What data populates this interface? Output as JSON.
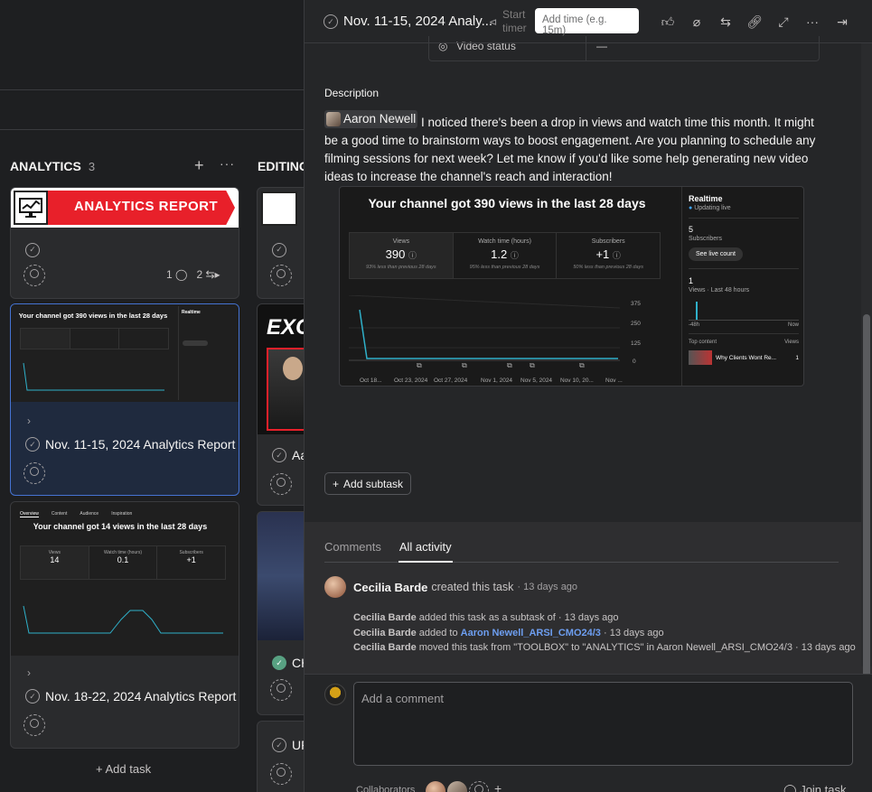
{
  "board": {
    "columns": [
      {
        "title": "ANALYTICS",
        "count": "3",
        "cards": [
          {
            "banner_text": "ANALYTICS REPORT",
            "comments": "1",
            "subtasks": "2"
          },
          {
            "title": "Nov. 11-15, 2024 Analytics Report",
            "preview_title": "Your channel got 390 views in the last 28 days"
          },
          {
            "title": "Nov. 18-22, 2024 Analytics Report",
            "preview_title": "Your channel got 14 views in the last 28 days",
            "preview_tabs": [
              "Overview",
              "Content",
              "Audience",
              "Inspiration"
            ],
            "preview_stats": [
              {
                "label": "Views",
                "value": "14"
              },
              {
                "label": "Watch time (hours)",
                "value": "0.1"
              },
              {
                "label": "Subscribers",
                "value": "+1"
              }
            ]
          }
        ],
        "add_task": "Add task"
      },
      {
        "title": "EDITING",
        "cards": [
          {
            "title": "Aa"
          },
          {
            "title": "CH"
          },
          {
            "title": "UP"
          }
        ]
      }
    ]
  },
  "panel": {
    "title": "Nov. 11-15, 2024 Analy...",
    "start_timer": "Start timer",
    "add_time_placeholder": "Add time (e.g. 15m)",
    "video_status_label": "Video status",
    "video_status_value": "—",
    "description_label": "Description",
    "mention_name": "Aaron Newell",
    "description_text": " I noticed there's been a drop in views and watch time this month. It might be a good time to brainstorm ways to boost engagement. Are you planning to schedule any filming sessions for next week? Let me know if you'd like some help generating new video ideas to increase the channel's reach and interaction!",
    "embed": {
      "title": "Your channel got 390 views in the last 28 days",
      "stats": [
        {
          "label": "Views",
          "value": "390",
          "sub": "93% less than previous 28 days"
        },
        {
          "label": "Watch time (hours)",
          "value": "1.2",
          "sub": "95% less than previous 28 days"
        },
        {
          "label": "Subscribers",
          "value": "+1",
          "sub": "50% less than previous 28 days"
        }
      ],
      "y_ticks": [
        "375",
        "250",
        "125",
        "0"
      ],
      "x_ticks": [
        "Oct 18...",
        "Oct 23, 2024",
        "Oct 27, 2024",
        "Nov 1, 2024",
        "Nov 5, 2024",
        "Nov 10, 20...",
        "Nov ..."
      ],
      "realtime_title": "Realtime",
      "realtime_status": "Updating live",
      "subs_value": "5",
      "subs_label": "Subscribers",
      "live_count_btn": "See live count",
      "views_value": "1",
      "views_label": "Views · Last 48 hours",
      "rt_x_start": "-48h",
      "rt_x_end": "Now",
      "top_content_label": "Top content",
      "top_content_views_label": "Views",
      "top_content_item": "Why Clients Wont Re...",
      "top_content_count": "1"
    },
    "add_subtask": "Add subtask",
    "tabs": [
      "Comments",
      "All activity"
    ],
    "activity": {
      "actor": "Cecilia Barde",
      "created_action": "created this task",
      "created_time": "· 13 days ago",
      "lines": [
        {
          "actor": "Cecilia Barde",
          "text": "added this task as a subtask of",
          "time": "· 13 days ago"
        },
        {
          "actor": "Cecilia Barde",
          "text": "added to",
          "link": "Aaron Newell_ARSI_CMO24/3",
          "time": "· 13 days ago"
        },
        {
          "actor": "Cecilia Barde",
          "text": "moved this task from \"TOOLBOX\" to \"ANALYTICS\" in Aaron Newell_ARSI_CMO24/3",
          "time": "· 13 days ago"
        }
      ]
    },
    "comment_placeholder": "Add a comment",
    "collaborators_label": "Collaborators",
    "join_task": "Join task"
  },
  "colors": {
    "accent": "#4573d2",
    "bg": "#1e1f21",
    "panel": "#252628",
    "banner_red": "#e8202a"
  }
}
